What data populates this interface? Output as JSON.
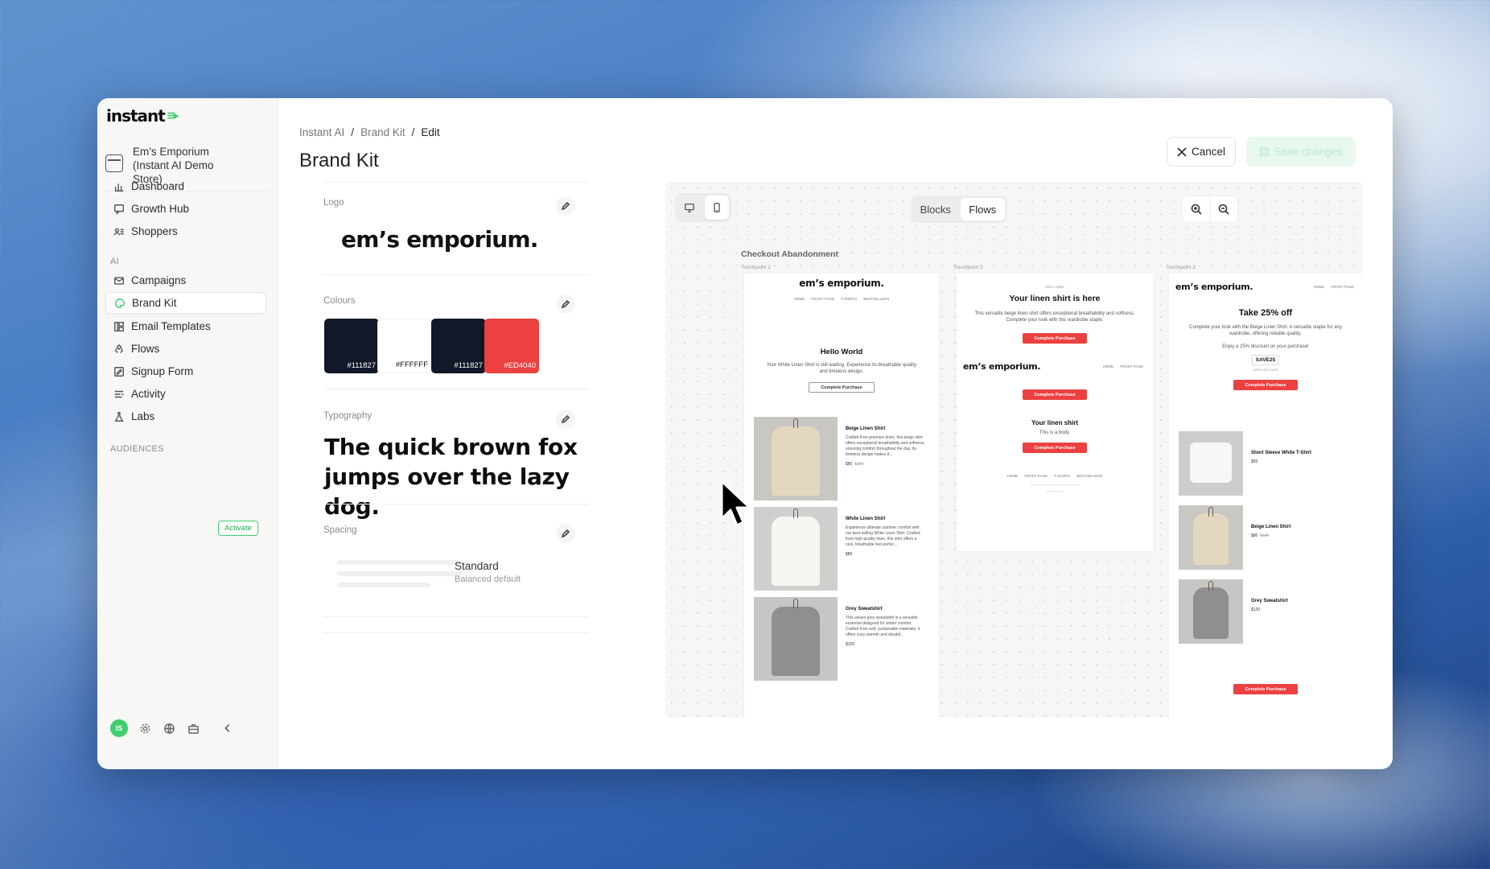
{
  "app": {
    "logo": "instant"
  },
  "sidebar": {
    "store_name_lines": [
      "Em's Emporium",
      "(Instant AI Demo",
      "Store)"
    ],
    "items_main": [
      {
        "label": "Dashboard",
        "icon": "bar-chart-icon"
      },
      {
        "label": "Growth Hub",
        "icon": "chat-icon"
      },
      {
        "label": "Shoppers",
        "icon": "users-icon"
      }
    ],
    "section_ai": "AI",
    "items_ai": [
      {
        "label": "Campaigns",
        "icon": "mail-icon"
      },
      {
        "label": "Brand Kit",
        "icon": "palette-icon",
        "active": true
      },
      {
        "label": "Email Templates",
        "icon": "template-icon"
      },
      {
        "label": "Flows",
        "icon": "flow-icon"
      },
      {
        "label": "Signup Form",
        "icon": "form-icon"
      },
      {
        "label": "Activity",
        "icon": "activity-icon"
      },
      {
        "label": "Labs",
        "icon": "flask-icon"
      }
    ],
    "section_audiences": "AUDIENCES",
    "activate_label": "Activate",
    "avatar_initials": "IS"
  },
  "breadcrumb": [
    "Instant AI",
    "Brand Kit",
    "Edit"
  ],
  "breadcrumb_sep": "/",
  "page_title": "Brand Kit",
  "actions": {
    "cancel": "Cancel",
    "save": "Save changes"
  },
  "brand_kit": {
    "logo_label": "Logo",
    "logo_text": "em’s emporium.",
    "colours_label": "Colours",
    "colours": [
      "#111827",
      "#FFFFFF",
      "#111827",
      "#ED4040"
    ],
    "typography_label": "Typography",
    "typography_sample": "The quick brown fox jumps over the lazy dog.",
    "spacing_label": "Spacing",
    "spacing_name": "Standard",
    "spacing_desc": "Balanced default"
  },
  "preview": {
    "view_tabs": [
      "Blocks",
      "Flows"
    ],
    "active_view": "Flows",
    "flow_title": "Checkout Abandonment",
    "touchpoints": [
      "Touchpoint 1",
      "Touchpoint 2",
      "Touchpoint 3"
    ],
    "email1": {
      "brand": "em’s emporium.",
      "nav": [
        "HOME",
        "FRONT PAGE",
        "T-SHIRTS",
        "BESTSELLERS"
      ],
      "heading": "Hello World",
      "body": "Your White Linen Shirt is still waiting. Experience its breathable quality and timeless design.",
      "cta": "Complete Purchase",
      "products": [
        {
          "name": "Beige Linen Shirt",
          "desc": "Crafted from premium linen, this beige shirt offers exceptional breathability and softness, ensuring comfort throughout the day. Its timeless design makes it...",
          "price": "$80",
          "old_price": "$100"
        },
        {
          "name": "White Linen Shirt",
          "desc": "Experience ultimate summer comfort with our best-selling White Linen Shirt. Crafted from high-quality linen, this shirt offers a cool, breathable feel perfec...",
          "price": "$80"
        },
        {
          "name": "Grey Sweatshirt",
          "desc": "This unisex grey sweatshirt is a versatile essential designed for winter comfort. Crafted from soft, sustainable materials, it offers cozy warmth and durabil...",
          "price": "$120"
        }
      ]
    },
    "email2": {
      "add_label": "ADD LABEL",
      "heading": "Your linen shirt is here",
      "body": "This versatile beige linen shirt offers exceptional breathability and softness. Complete your look with this wardrobe staple.",
      "cta": "Complete Purchase",
      "brand": "em’s emporium.",
      "nav": [
        "HOME",
        "FRONT PAGE"
      ],
      "sub_heading": "Your linen shirt",
      "sub_body": "This is a body.",
      "footer_nav": [
        "HOME",
        "FRONT PAGE",
        "T-SHIRTS",
        "BESTSELLERS"
      ]
    },
    "email3": {
      "brand": "em’s emporium.",
      "nav": [
        "HOME",
        "FRONT PAGE"
      ],
      "heading": "Take 25% off",
      "body": "Complete your look with the Beige Linen Shirt. A versatile staple for any wardrobe, offering reliable quality.",
      "discount_text": "Enjoy a 25% discount on your purchase!",
      "code": "SAVE25",
      "code_note": "Valid until 11/26",
      "cta": "Complete Purchase",
      "products": [
        {
          "name": "Short Sleeve White T-Shirt",
          "price": "$50"
        },
        {
          "name": "Beige Linen Shirt",
          "price": "$80",
          "old_price": "$100"
        },
        {
          "name": "Grey Sweatshirt",
          "price": "$120"
        }
      ]
    }
  }
}
